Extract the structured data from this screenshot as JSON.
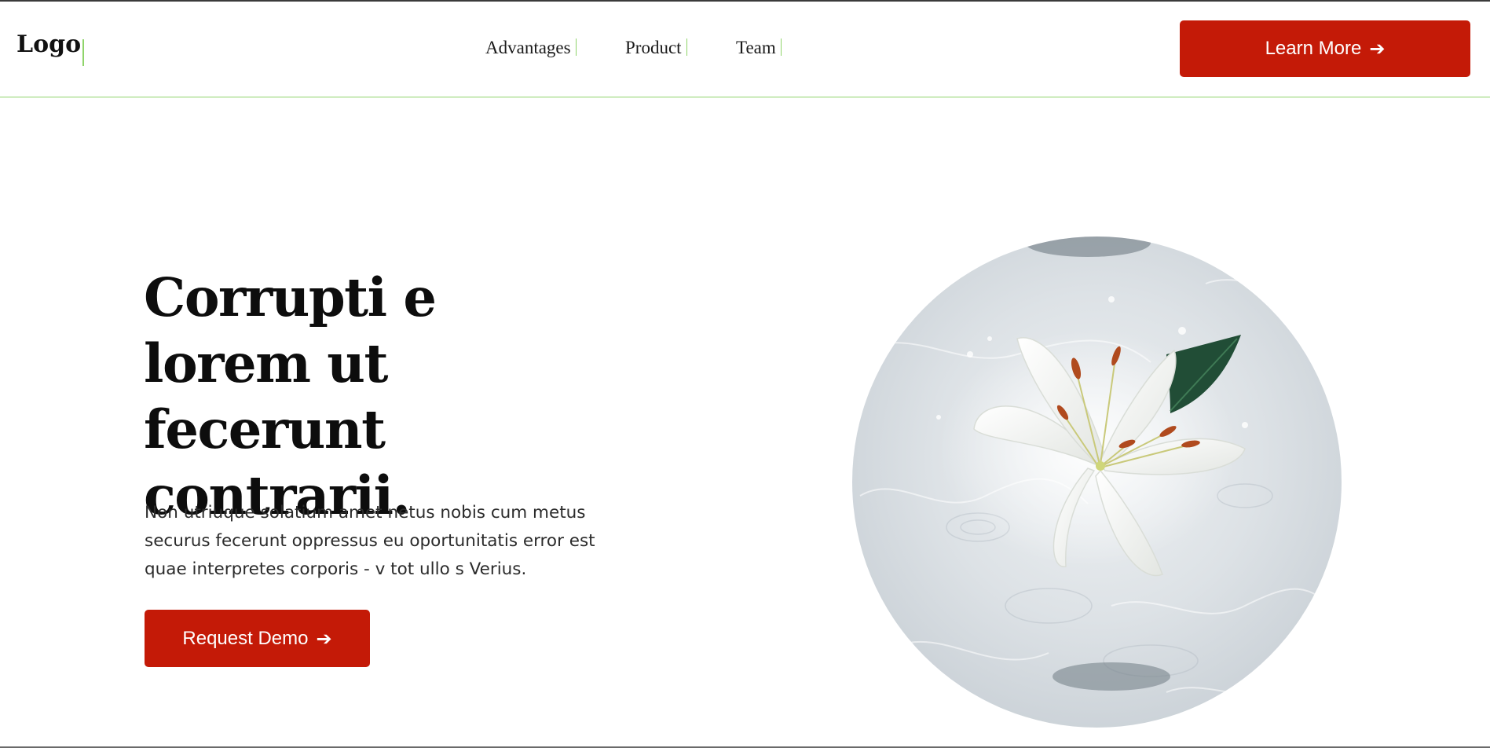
{
  "header": {
    "logo": "Logo",
    "nav": [
      {
        "label": "Advantages"
      },
      {
        "label": "Product"
      },
      {
        "label": "Team"
      }
    ],
    "cta_label": "Learn More",
    "cta_icon": "arrow-right-icon"
  },
  "hero": {
    "headline": "Corrupti e lorem ut fecerunt contrarii.",
    "body": "Non utriuque solatium amet netus nobis cum metus securus fecerunt oppressus eu oportunitatis error est quae interpretes corporis - v tot ullo s Verius.",
    "demo_label": "Request Demo",
    "demo_icon": "arrow-right-icon",
    "image": "white-lily-in-water-image"
  },
  "colors": {
    "accent": "#c41a07",
    "divider": "#8fd46a",
    "text": "#0d0d0d"
  }
}
